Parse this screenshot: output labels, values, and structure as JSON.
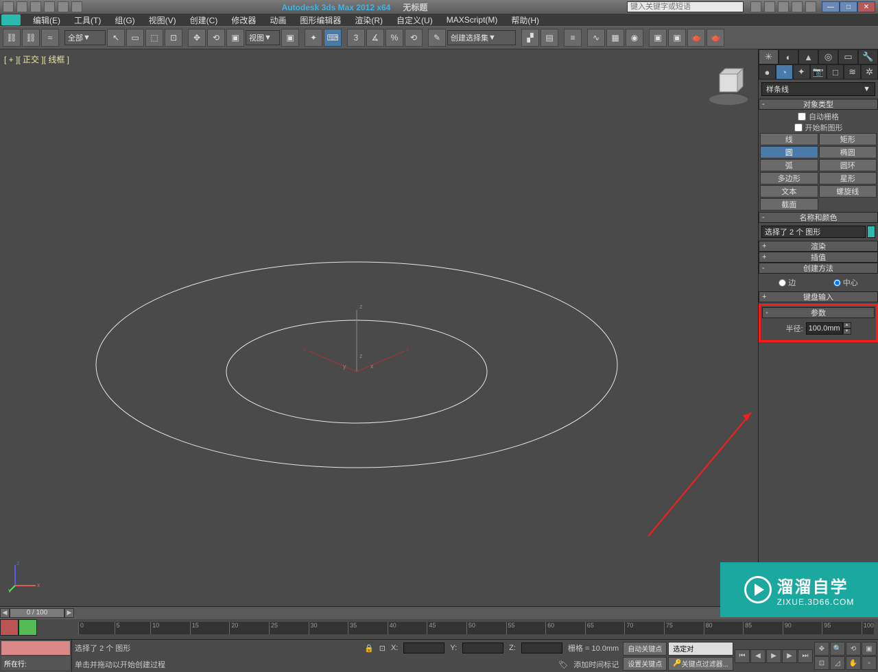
{
  "titlebar": {
    "app_title": "Autodesk 3ds Max 2012 x64",
    "doc_title": "无标题",
    "search_placeholder": "键入关键字或短语"
  },
  "menu": {
    "items": [
      "编辑(E)",
      "工具(T)",
      "组(G)",
      "视图(V)",
      "创建(C)",
      "修改器",
      "动画",
      "图形编辑器",
      "渲染(R)",
      "自定义(U)",
      "MAXScript(M)",
      "帮助(H)"
    ]
  },
  "toolbar": {
    "filter_dropdown": "全部",
    "view_dropdown": "视图",
    "named_sel_dropdown": "创建选择集"
  },
  "viewport": {
    "label": "[ + ][ 正交 ][ 线框 ]"
  },
  "cmdpanel": {
    "category_dropdown": "样条线",
    "object_type_header": "对象类型",
    "autogrid_label": "自动栅格",
    "start_new_shape_label": "开始新图形",
    "shapes": [
      [
        "线",
        "矩形"
      ],
      [
        "圆",
        "椭圆"
      ],
      [
        "弧",
        "圆环"
      ],
      [
        "多边形",
        "星形"
      ],
      [
        "文本",
        "螺旋线"
      ],
      [
        "截面",
        ""
      ]
    ],
    "active_shape": "圆",
    "name_color_header": "名称和颜色",
    "name_value": "选择了 2 个 图形",
    "render_header": "渲染",
    "interp_header": "插值",
    "create_method_header": "创建方法",
    "radio_edge": "边",
    "radio_center": "中心",
    "keyboard_header": "键盘输入",
    "params_header": "参数",
    "radius_label": "半径:",
    "radius_value": "100.0mm"
  },
  "timeline": {
    "slider_label": "0 / 100",
    "ticks": [
      "0",
      "5",
      "10",
      "15",
      "20",
      "25",
      "30",
      "35",
      "40",
      "45",
      "50",
      "55",
      "60",
      "65",
      "70",
      "75",
      "80",
      "85",
      "90",
      "95",
      "100"
    ]
  },
  "statusbar": {
    "script_btn": "",
    "line_label": "所在行:",
    "prompt1": "选择了 2 个 图形",
    "prompt2": "单击并拖动以开始创建过程",
    "x_label": "X:",
    "y_label": "Y:",
    "z_label": "Z:",
    "grid_label": "栅格 = 10.0mm",
    "add_time_tag": "添加时间标记",
    "auto_key": "自动关键点",
    "set_key": "设置关键点",
    "selected": "选定对",
    "key_filter": "关键点过滤器..."
  },
  "watermark": {
    "title": "溜溜自学",
    "url": "ZIXUE.3D66.COM"
  }
}
